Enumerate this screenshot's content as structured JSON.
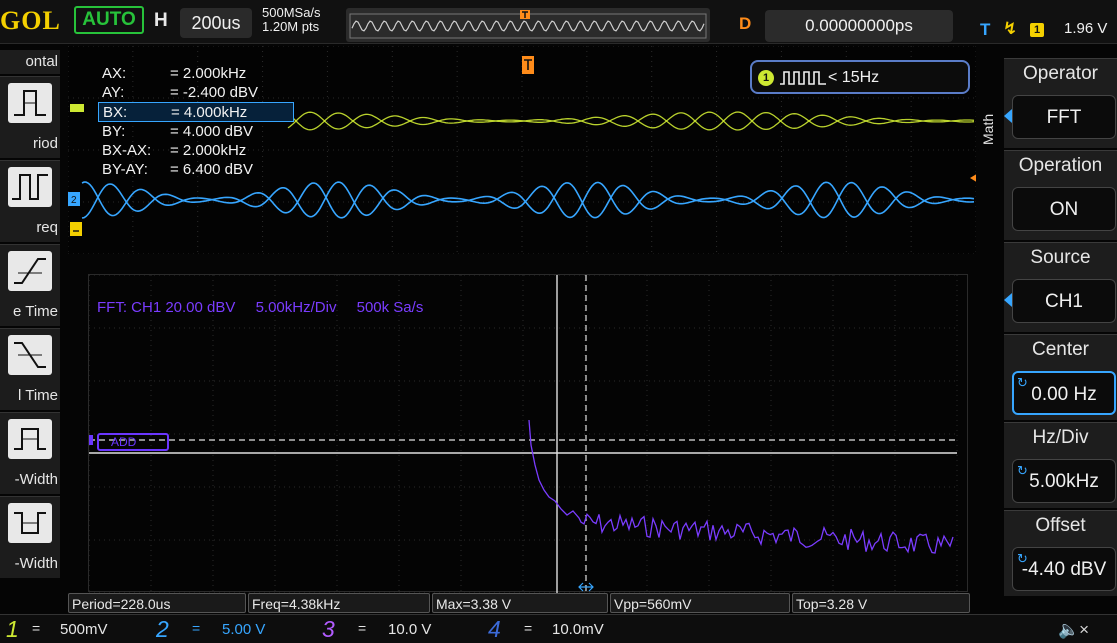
{
  "topbar": {
    "brand": "GOL",
    "run_state": "AUTO",
    "horizontal_label": "H",
    "timebase": "200us",
    "sample_rate": "500MSa/s",
    "memory_depth": "1.20M pts",
    "delay_label": "D",
    "delay_value": "0.00000000ps",
    "trigger_label": "T",
    "trigger_channel": "1",
    "trigger_level": "1.96 V"
  },
  "left_menu": {
    "header": "ontal",
    "items": [
      {
        "label": "riod"
      },
      {
        "label": "req"
      },
      {
        "label": "e Time"
      },
      {
        "label": "l Time"
      },
      {
        "label": "-Width"
      },
      {
        "label": "-Width"
      }
    ]
  },
  "cursor_readout": {
    "rows": [
      {
        "key": "AX:",
        "value": "=  2.000kHz"
      },
      {
        "key": "AY:",
        "value": "=  -2.400 dBV"
      },
      {
        "key": "BX:",
        "value": "=  4.000kHz"
      },
      {
        "key": "BY:",
        "value": "=  4.000 dBV"
      },
      {
        "key": "BX-AX:",
        "value": "=  2.000kHz"
      },
      {
        "key": "BY-AY:",
        "value": "=  6.400 dBV"
      }
    ],
    "selected_index": 2
  },
  "trigger_info": {
    "channel": "1",
    "text": "< 15Hz"
  },
  "fft_info": {
    "source_scale": "FFT:  CH1  20.00 dBV",
    "hz_div": "5.00kHz/Div",
    "sample_rate": "500k Sa/s",
    "ref_label": "ADD"
  },
  "right_menu": {
    "side_tag": "Math",
    "items": [
      {
        "title": "Operator",
        "value": "FFT",
        "arrow": true
      },
      {
        "title": "Operation",
        "value": "ON",
        "arrow": false
      },
      {
        "title": "Source",
        "value": "CH1",
        "arrow": true
      },
      {
        "title": "Center",
        "value": "0.00 Hz",
        "knob": true,
        "active": true
      },
      {
        "title": "Hz/Div",
        "value": "5.00kHz",
        "knob": true
      },
      {
        "title": "Offset",
        "value": "-4.40 dBV",
        "knob": true
      }
    ]
  },
  "measurements": [
    {
      "text": "Period=228.0us"
    },
    {
      "text": "Freq=4.38kHz"
    },
    {
      "text": "Max=3.38 V"
    },
    {
      "text": "Vpp=560mV"
    },
    {
      "text": "Top=3.28 V"
    }
  ],
  "channels": [
    {
      "num": "1",
      "scale": "500mV",
      "color": "#cde832"
    },
    {
      "num": "2",
      "scale": "5.00 V",
      "color": "#37a6ff"
    },
    {
      "num": "3",
      "scale": "10.0 V",
      "color": "#b25cff"
    },
    {
      "num": "4",
      "scale": "10.0mV",
      "color": "#3c6bd9"
    }
  ],
  "colors": {
    "ch1": "#cde832",
    "ch2": "#37a6ff",
    "math": "#6b36ff",
    "delay": "#ff8c1a",
    "brand": "#f4d000"
  }
}
